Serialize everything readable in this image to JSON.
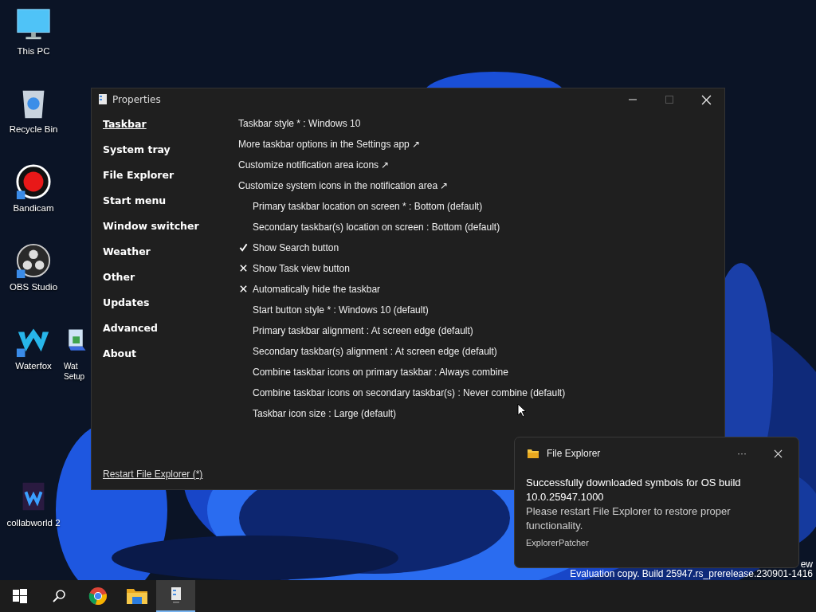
{
  "desktop_icons": [
    {
      "kind": "pc",
      "label": "This PC"
    },
    {
      "kind": "bin",
      "label": "Recycle Bin"
    },
    {
      "kind": "bandicam",
      "label": "Bandicam"
    },
    {
      "kind": "obs",
      "label": "OBS Studio"
    },
    {
      "kind": "waterfox",
      "label": "Waterfox"
    },
    {
      "kind": "setup",
      "label": "Wat Setup"
    },
    {
      "kind": "collab",
      "label": "collabworld 2"
    }
  ],
  "window": {
    "title": "Properties",
    "controls": [
      {
        "kind": "minimize",
        "disabled": false
      },
      {
        "kind": "maximize",
        "disabled": true
      },
      {
        "kind": "close",
        "disabled": false
      }
    ],
    "sidebar": {
      "items": [
        {
          "label": "Taskbar",
          "selected": true
        },
        {
          "label": "System tray",
          "selected": false
        },
        {
          "label": "File Explorer",
          "selected": false
        },
        {
          "label": "Start menu",
          "selected": false
        },
        {
          "label": "Window switcher",
          "selected": false
        },
        {
          "label": "Weather",
          "selected": false
        },
        {
          "label": "Other",
          "selected": false
        },
        {
          "label": "Updates",
          "selected": false
        },
        {
          "label": "Advanced",
          "selected": false
        },
        {
          "label": "About",
          "selected": false
        }
      ]
    },
    "settings": [
      {
        "kind": "plain",
        "text": "Taskbar style * : Windows 10"
      },
      {
        "kind": "link",
        "text": "More taskbar options in the Settings app ↗"
      },
      {
        "kind": "link",
        "text": "Customize notification area icons ↗"
      },
      {
        "kind": "link",
        "text": "Customize system icons in the notification area ↗"
      },
      {
        "kind": "option",
        "text": "Primary taskbar location on screen * : Bottom (default)"
      },
      {
        "kind": "option",
        "text": "Secondary taskbar(s) location on screen : Bottom (default)"
      },
      {
        "kind": "toggle",
        "text": "Show Search button",
        "checked": true
      },
      {
        "kind": "toggle",
        "text": "Show Task view button",
        "checked": false
      },
      {
        "kind": "toggle",
        "text": "Automatically hide the taskbar",
        "checked": false
      },
      {
        "kind": "option",
        "text": "Start button style * : Windows 10 (default)"
      },
      {
        "kind": "option",
        "text": "Primary taskbar alignment : At screen edge (default)"
      },
      {
        "kind": "option",
        "text": "Secondary taskbar(s) alignment : At screen edge (default)"
      },
      {
        "kind": "option",
        "text": "Combine taskbar icons on primary taskbar : Always combine"
      },
      {
        "kind": "option",
        "text": "Combine taskbar icons on secondary taskbar(s) : Never combine (default)"
      },
      {
        "kind": "option",
        "text": "Taskbar icon size : Large (default)"
      }
    ],
    "footer_link": "Restart File Explorer (*)"
  },
  "watermark": [
    "ew",
    "Evaluation copy. Build 25947.rs_prerelease.230901-1416"
  ],
  "toast": {
    "app": "File Explorer",
    "more": "···",
    "title": "Successfully downloaded symbols for OS build 10.0.25947.1000",
    "body": "Please restart File Explorer to restore proper functionality.",
    "source": "ExplorerPatcher"
  },
  "taskbar": [
    {
      "kind": "start",
      "selected": false
    },
    {
      "kind": "search",
      "selected": false
    },
    {
      "kind": "browser",
      "selected": false
    },
    {
      "kind": "folder",
      "selected": false
    },
    {
      "kind": "app",
      "selected": true
    }
  ]
}
